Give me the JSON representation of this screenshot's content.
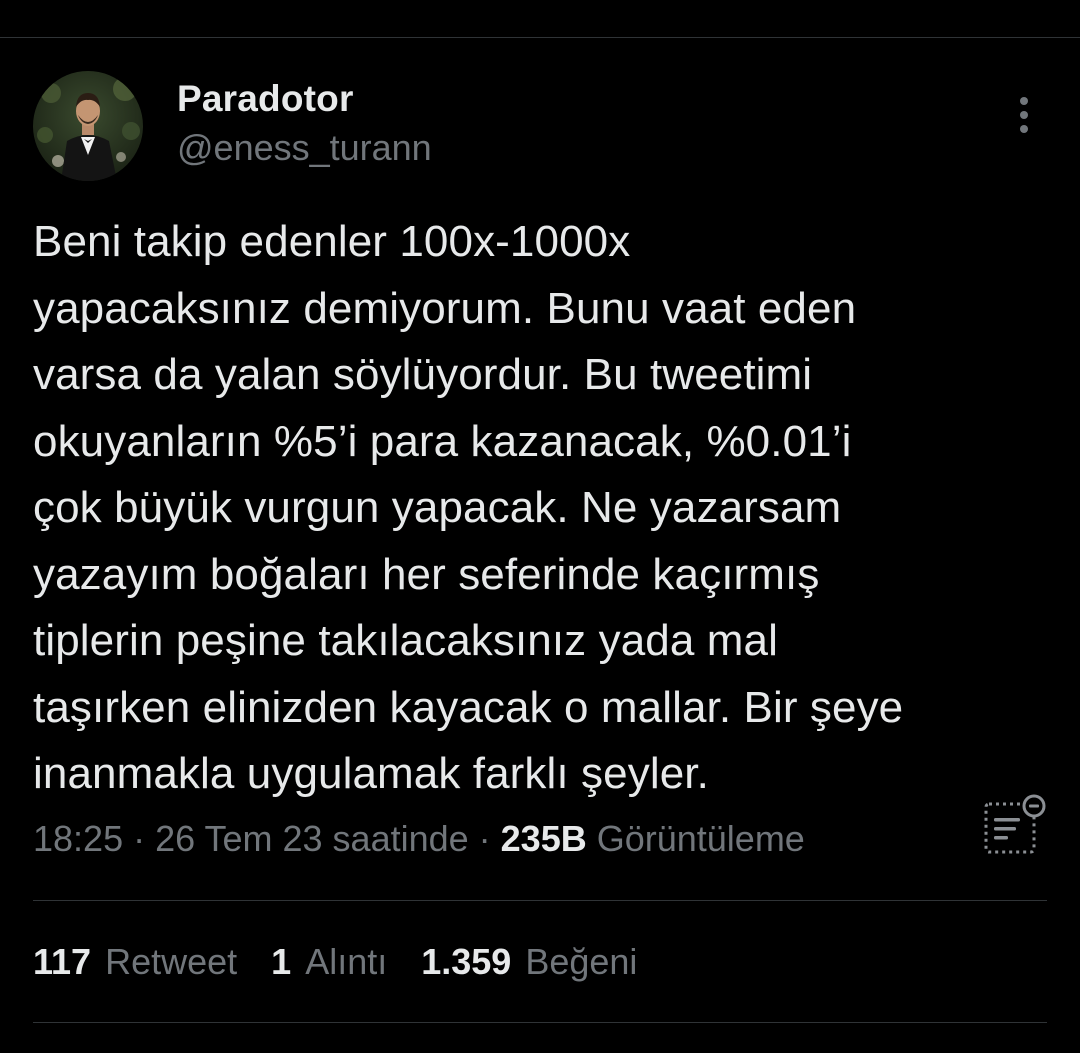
{
  "author": {
    "display_name": "Paradotor",
    "username": "@eness_turann",
    "avatar_icon": "profile-photo"
  },
  "tweet": {
    "text": "Beni takip edenler 100x-1000x\nyapacaksınız demiyorum. Bunu vaat eden\nvarsa da yalan söylüyordur. Bu tweetimi\nokuyanların %5’i para kazanacak, %0.01’i\nçok büyük vurgun yapacak. Ne yazarsam\nyazayım boğaları her seferinde kaçırmış\ntiplerin peşine takılacaksınız yada mal\ntaşırken elinizden kayacak o mallar. Bir şeye\ninanmakla uygulamak farklı şeyler."
  },
  "meta": {
    "time": "18:25",
    "separator": "·",
    "date": "26 Tem 23 saatinde",
    "views_count": "235B",
    "views_label": "Görüntüleme"
  },
  "stats": [
    {
      "count": "117",
      "label": "Retweet"
    },
    {
      "count": "1",
      "label": "Alıntı"
    },
    {
      "count": "1.359",
      "label": "Beğeni"
    }
  ],
  "icons": {
    "more": "more-vertical-icon",
    "analytics": "analytics-icon"
  },
  "colors": {
    "background": "#000000",
    "primary_text": "#e7e9ea",
    "secondary_text": "#71767b",
    "divider": "#2f3336"
  }
}
